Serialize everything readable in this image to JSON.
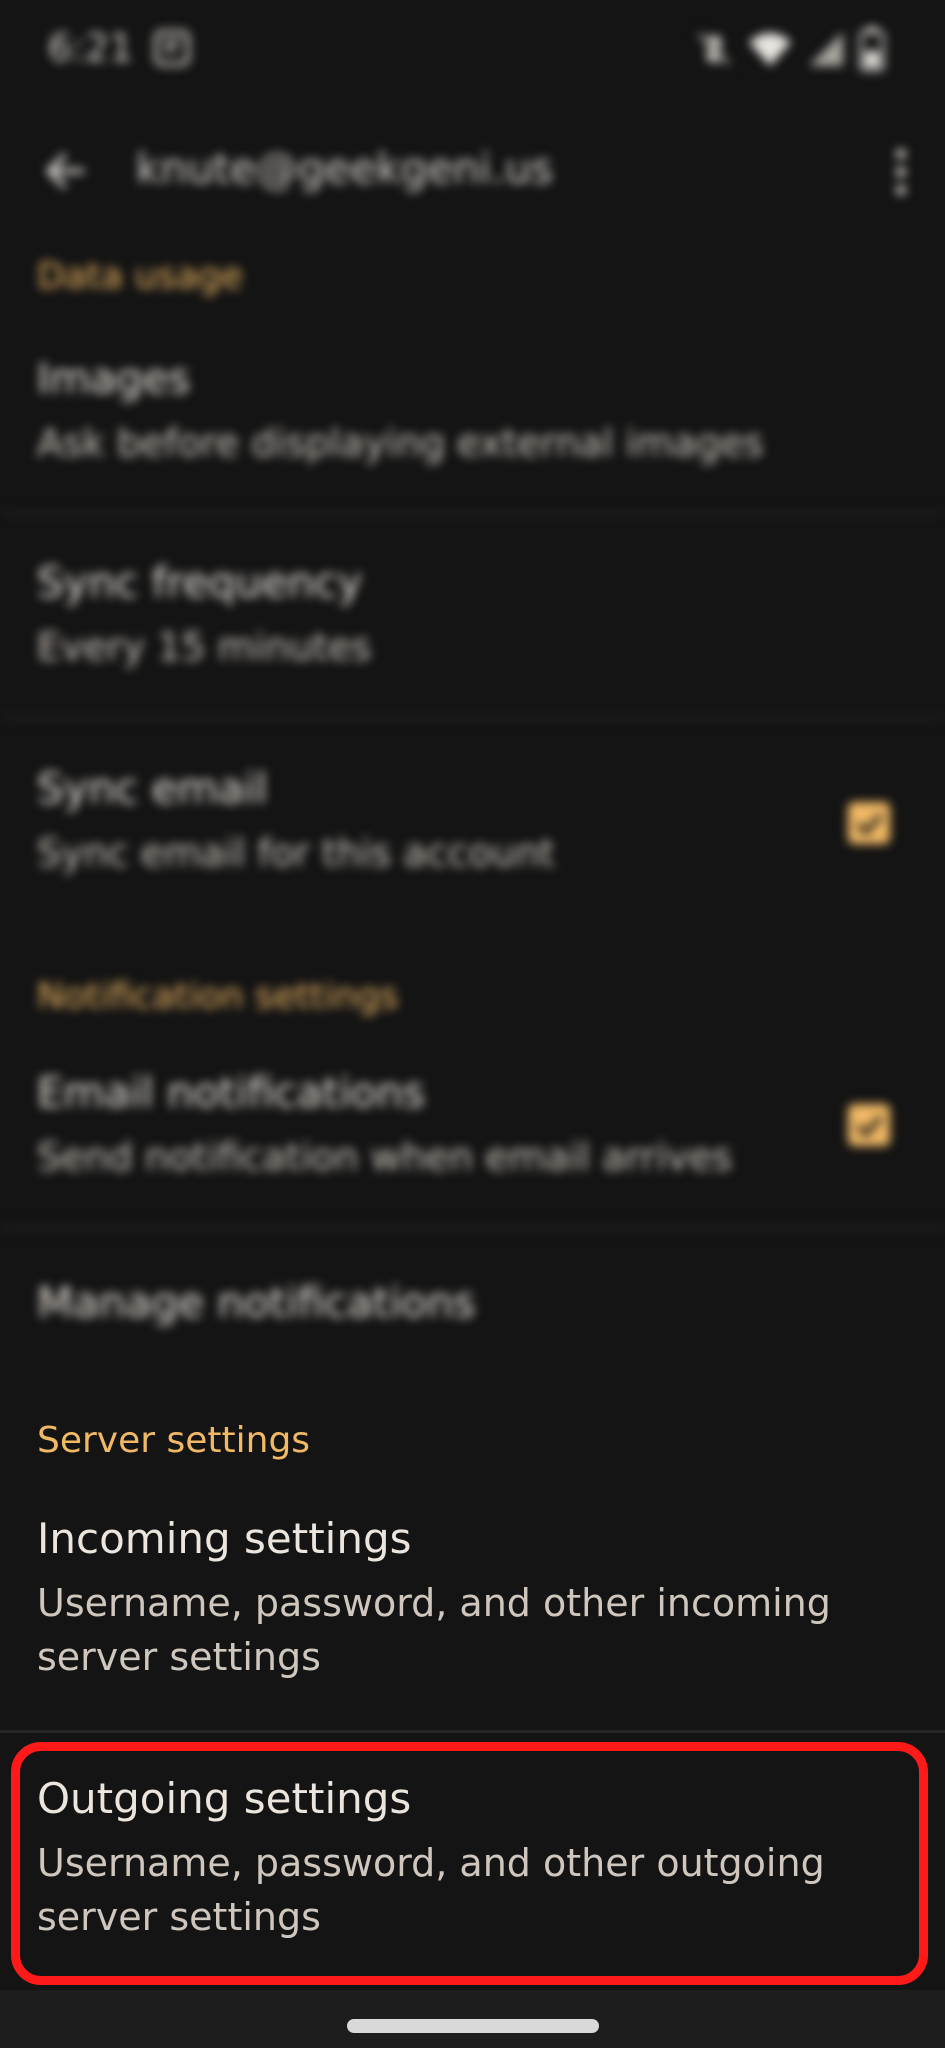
{
  "status_bar": {
    "time": "6:21"
  },
  "app_bar": {
    "title": "knute@geekgeni.us"
  },
  "data_usage": {
    "header": "Data usage",
    "images": {
      "title": "Images",
      "summary": "Ask before displaying external images"
    },
    "sync_frequency": {
      "title": "Sync frequency",
      "summary": "Every 15 minutes"
    },
    "sync_email": {
      "title": "Sync email",
      "summary": "Sync email for this account",
      "checked": true
    }
  },
  "notification_settings": {
    "header": "Notification settings",
    "email_notifications": {
      "title": "Email notifications",
      "summary": "Send notification when email arrives",
      "checked": true
    },
    "manage_notifications": {
      "title": "Manage notifications"
    }
  },
  "server_settings": {
    "header": "Server settings",
    "incoming": {
      "title": "Incoming settings",
      "summary_line1": "Username, password, and other incoming",
      "summary_line2": "server settings"
    },
    "outgoing": {
      "title": "Outgoing settings",
      "summary_line1": "Username, password, and other outgoing",
      "summary_line2": "server settings"
    }
  },
  "colors": {
    "background": "#141414",
    "accent": "#f1b965",
    "highlight": "#ff1a1a"
  }
}
